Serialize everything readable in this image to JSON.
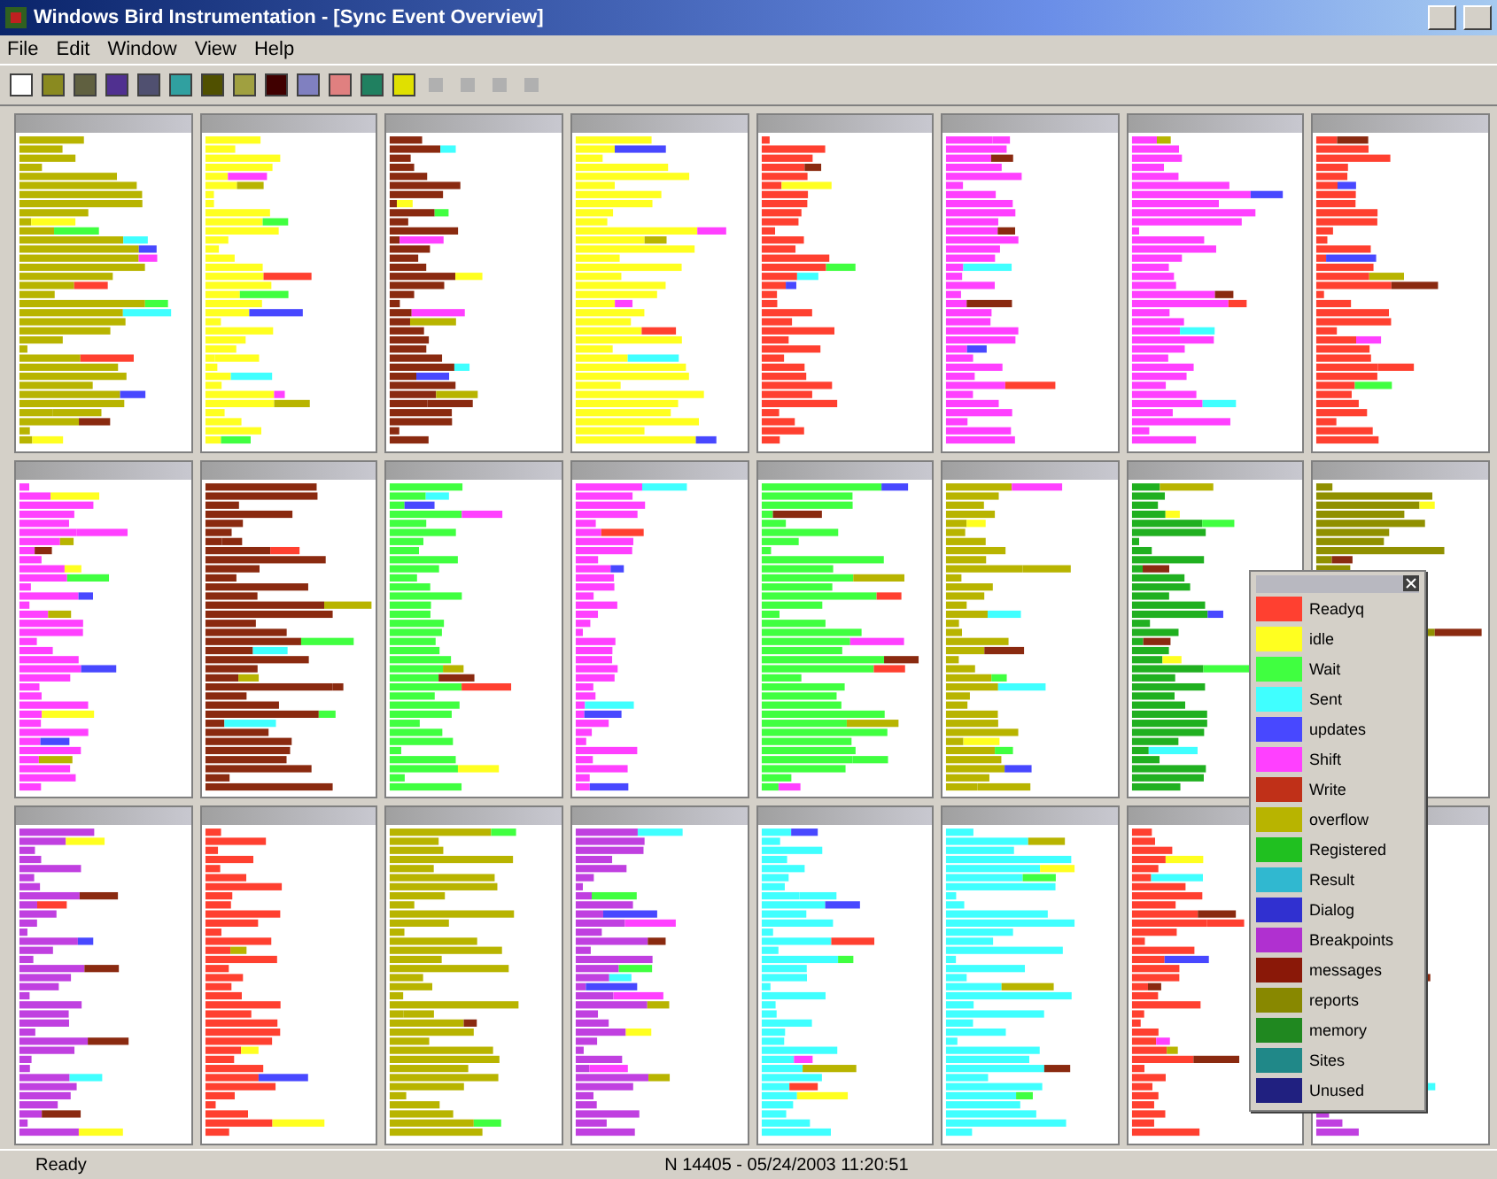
{
  "window": {
    "title": "Windows Bird Instrumentation - [Sync Event Overview]"
  },
  "menu": [
    "File",
    "Edit",
    "Window",
    "View",
    "Help"
  ],
  "panels": [
    {
      "color": "#b8b400"
    },
    {
      "color": "#ffff20"
    },
    {
      "color": "#8a2a10"
    },
    {
      "color": "#ffff20"
    },
    {
      "color": "#ff4030"
    },
    {
      "color": "#ff40ff"
    },
    {
      "color": "#ff40ff"
    },
    {
      "color": "#ff4030"
    },
    {
      "color": "#ff40ff"
    },
    {
      "color": "#8a2a10"
    },
    {
      "color": "#40ff40"
    },
    {
      "color": "#ff40ff"
    },
    {
      "color": "#40ff40"
    },
    {
      "color": "#b8b400"
    },
    {
      "color": "#20b020"
    },
    {
      "color": "#909000"
    },
    {
      "color": "#c040e0"
    },
    {
      "color": "#ff4030"
    },
    {
      "color": "#b8b400"
    },
    {
      "color": "#c040e0"
    },
    {
      "color": "#40ffff"
    },
    {
      "color": "#40ffff"
    },
    {
      "color": "#ff4030"
    },
    {
      "color": "#c040e0"
    }
  ],
  "legend": {
    "items": [
      {
        "label": "Readyq",
        "color": "#ff4030"
      },
      {
        "label": "idle",
        "color": "#ffff20"
      },
      {
        "label": "Wait",
        "color": "#40ff40"
      },
      {
        "label": "Sent",
        "color": "#40ffff"
      },
      {
        "label": "updates",
        "color": "#4848ff"
      },
      {
        "label": "Shift",
        "color": "#ff40ff"
      },
      {
        "label": "Write",
        "color": "#c03018"
      },
      {
        "label": "overflow",
        "color": "#b8b400"
      },
      {
        "label": "Registered",
        "color": "#20c020"
      },
      {
        "label": "Result",
        "color": "#30b8d0"
      },
      {
        "label": "Dialog",
        "color": "#3030d0"
      },
      {
        "label": "Breakpoints",
        "color": "#b030d0"
      },
      {
        "label": "messages",
        "color": "#8a1808"
      },
      {
        "label": "reports",
        "color": "#888800"
      },
      {
        "label": "memory",
        "color": "#208820"
      },
      {
        "label": "Sites",
        "color": "#208888"
      },
      {
        "label": "Unused",
        "color": "#202080"
      }
    ]
  },
  "status_bar": {
    "left": "Ready",
    "right": "N 14405 - 05/24/2003 11:20:51"
  }
}
